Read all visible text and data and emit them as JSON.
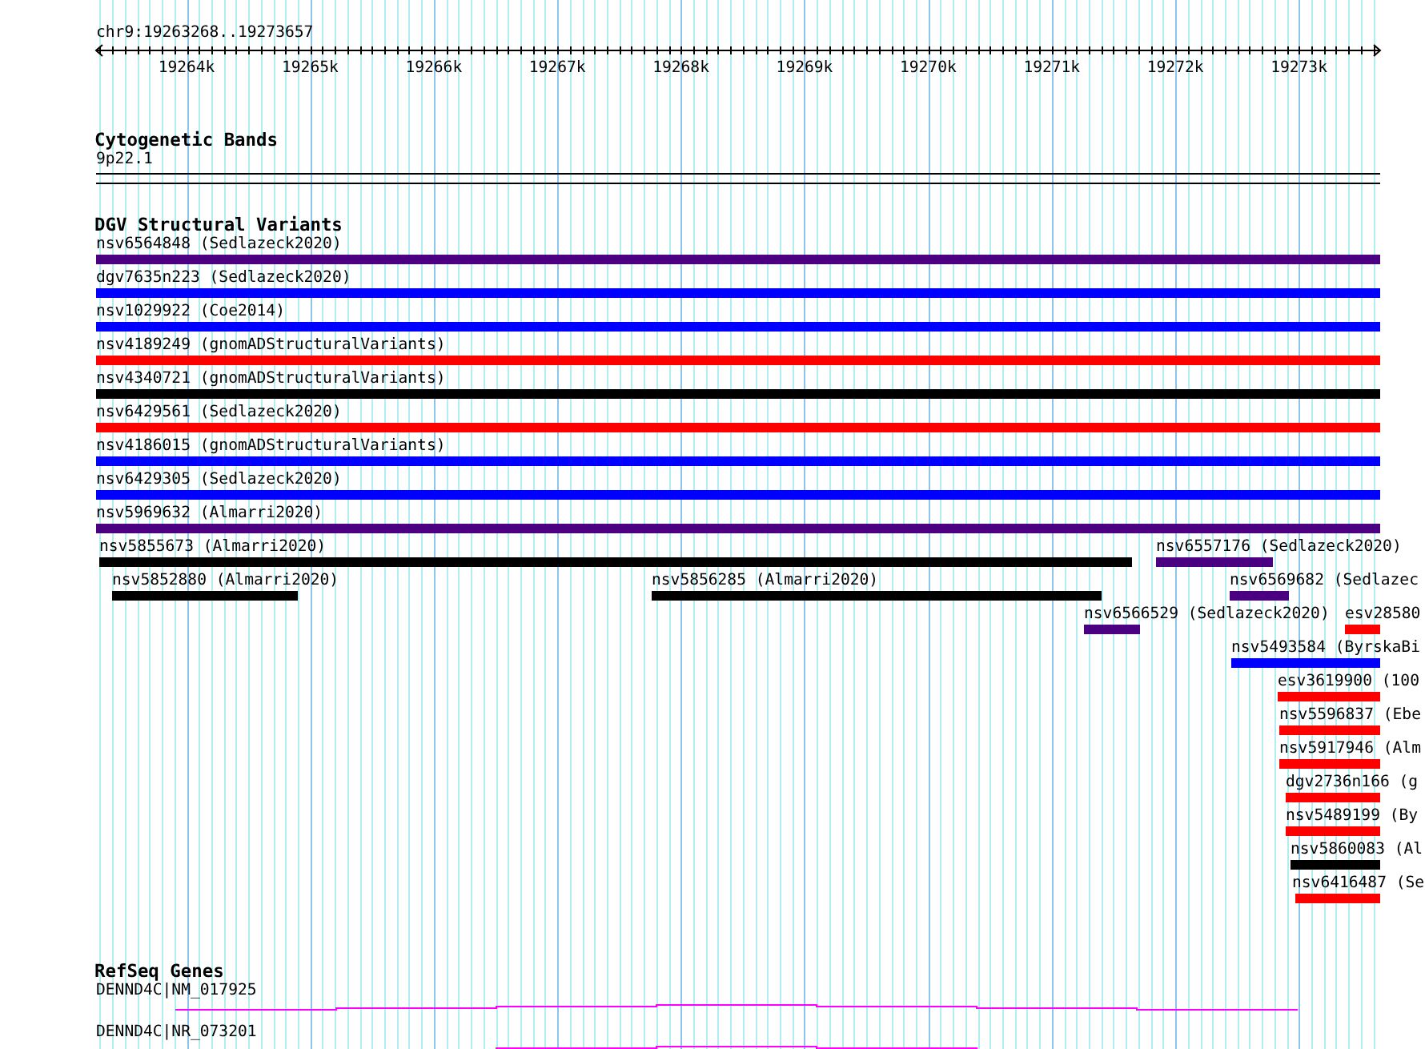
{
  "ruler": {
    "position": "chr9:19263268..19273657",
    "ticks": [
      "19264k",
      "19265k",
      "19266k",
      "19267k",
      "19268k",
      "19269k",
      "19270k",
      "19271k",
      "19272k",
      "19273k"
    ]
  },
  "tracks": [
    {
      "kind": "cytoband",
      "title": "Cytogenetic Bands",
      "items": [
        {
          "label": "9p22.1"
        }
      ]
    },
    {
      "kind": "variants",
      "title": "DGV Structural Variants",
      "rows": [
        [
          {
            "label": "nsv6564848 (Sedlazeck2020)",
            "color": "#4b0082"
          }
        ],
        [
          {
            "label": "dgv7635n223 (Sedlazeck2020)",
            "color": "#0000ff"
          }
        ],
        [
          {
            "label": "nsv1029922 (Coe2014)",
            "color": "#0000ff"
          }
        ],
        [
          {
            "label": "nsv4189249 (gnomADStructuralVariants)",
            "color": "#ff0000"
          }
        ],
        [
          {
            "label": "nsv4340721 (gnomADStructuralVariants)",
            "color": "#000000"
          }
        ],
        [
          {
            "label": "nsv6429561 (Sedlazeck2020)",
            "color": "#ff0000"
          }
        ],
        [
          {
            "label": "nsv4186015 (gnomADStructuralVariants)",
            "color": "#0000ff"
          }
        ],
        [
          {
            "label": "nsv6429305 (Sedlazeck2020)",
            "color": "#0000ff"
          }
        ],
        [
          {
            "label": "nsv5969632 (Almarri2020)",
            "color": "#4b0082"
          }
        ],
        [
          {
            "label": "nsv5855673 (Almarri2020)",
            "color": "#000000"
          },
          {
            "label": "nsv6557176 (Sedlazeck2020)",
            "color": "#4b0082"
          }
        ],
        [
          {
            "label": "nsv5852880 (Almarri2020)",
            "color": "#000000"
          },
          {
            "label": "nsv5856285 (Almarri2020)",
            "color": "#000000"
          },
          {
            "label": "nsv6569682 (Sedlazec",
            "color": "#4b0082"
          }
        ],
        [
          {
            "label": "nsv6566529 (Sedlazeck2020)",
            "color": "#4b0082"
          },
          {
            "label": "esv28580",
            "color": "#ff0000"
          }
        ],
        [
          {
            "label": "nsv5493584 (ByrskaBi",
            "color": "#0000ff"
          }
        ],
        [
          {
            "label": "esv3619900 (100",
            "color": "#ff0000"
          }
        ],
        [
          {
            "label": "nsv5596837 (Ebe",
            "color": "#ff0000"
          }
        ],
        [
          {
            "label": "nsv5917946 (Alm",
            "color": "#ff0000"
          }
        ],
        [
          {
            "label": "dgv2736n166 (g",
            "color": "#ff0000"
          }
        ],
        [
          {
            "label": "nsv5489199 (By",
            "color": "#ff0000"
          }
        ],
        [
          {
            "label": "nsv5860083 (Al",
            "color": "#000000"
          }
        ],
        [
          {
            "label": "nsv6416487 (Se",
            "color": "#ff0000"
          }
        ]
      ]
    },
    {
      "kind": "genes",
      "title": "RefSeq Genes",
      "items": [
        {
          "label": "DENND4C|NM_017925"
        },
        {
          "label": "DENND4C|NR_073201"
        }
      ]
    }
  ]
}
